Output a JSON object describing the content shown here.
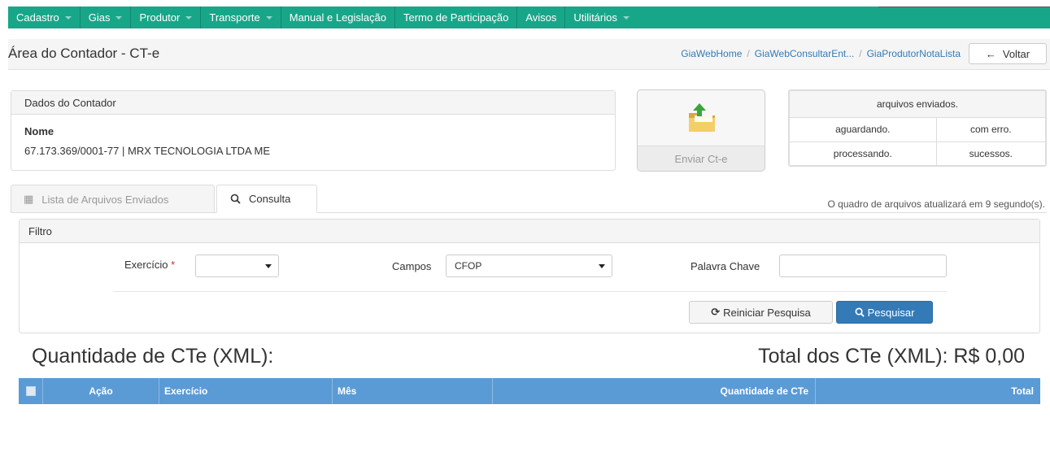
{
  "nav": {
    "items": [
      {
        "label": "Cadastro",
        "dropdown": true
      },
      {
        "label": "Gias",
        "dropdown": true
      },
      {
        "label": "Produtor",
        "dropdown": true
      },
      {
        "label": "Transporte",
        "dropdown": true
      },
      {
        "label": "Manual e Legislação",
        "dropdown": false
      },
      {
        "label": "Termo de Participação",
        "dropdown": false
      },
      {
        "label": "Avisos",
        "dropdown": false
      },
      {
        "label": "Utilitários",
        "dropdown": true
      }
    ],
    "color": "#18a689"
  },
  "header": {
    "title": "Área do Contador - CT-e",
    "breadcrumb": [
      "GiaWebHome",
      "GiaWebConsultarEnt...",
      "GiaProdutorNotaLista"
    ],
    "back_label": "Voltar"
  },
  "contador": {
    "panel_title": "Dados do Contador",
    "name_label": "Nome",
    "name_value": "67.173.369/0001-77 | MRX TECNOLOGIA LTDA ME"
  },
  "upload": {
    "icon": "folder-upload-icon",
    "label": "Enviar Ct-e"
  },
  "stats": {
    "title": "arquivos enviados.",
    "waiting": "aguardando.",
    "error": "com erro.",
    "processing": "processando.",
    "success": "sucessos."
  },
  "tabs": [
    {
      "label": "Lista de Arquivos Enviados",
      "icon": "table-icon",
      "active": false
    },
    {
      "label": "Consulta",
      "icon": "search-icon",
      "active": true
    }
  ],
  "refresh_note": "O quadro de arquivos atualizará em 9 segundo(s).",
  "filter": {
    "title": "Filtro",
    "exercicio_label": "Exercício",
    "exercicio_required": "*",
    "exercicio_value": "",
    "campos_label": "Campos",
    "campos_value": "CFOP",
    "keyword_label": "Palavra Chave",
    "keyword_value": "",
    "reset_label": "Reiniciar Pesquisa",
    "search_label": "Pesquisar"
  },
  "summary": {
    "quantity_title": "Quantidade de CTe (XML):",
    "total_title": "Total dos CTe (XML): R$ 0,00"
  },
  "table": {
    "columns": [
      "Ação",
      "Exercício",
      "Mês",
      "Quantidade de CTe",
      "Total"
    ],
    "rows": [],
    "header_color": "#5b9bd5"
  }
}
